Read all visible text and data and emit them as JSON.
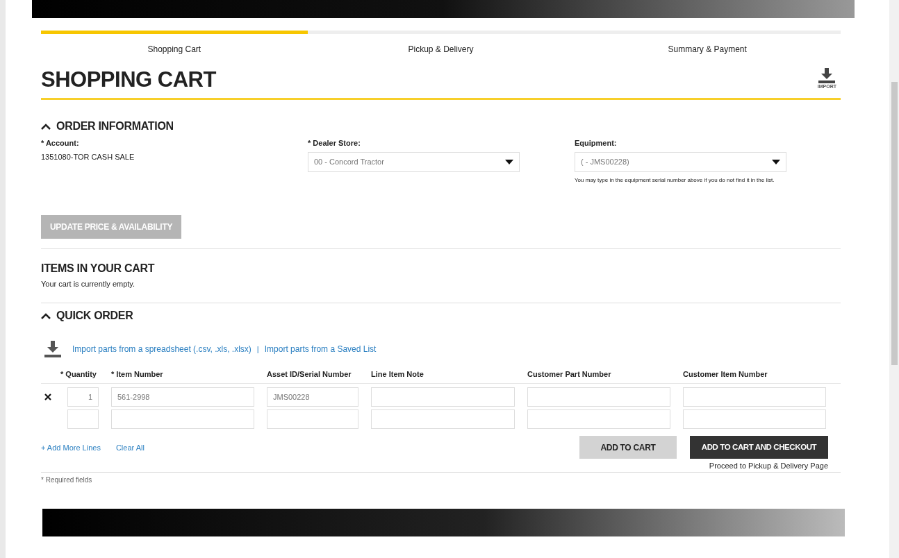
{
  "steps": [
    {
      "label": "Shopping Cart",
      "selected": true
    },
    {
      "label": "Pickup & Delivery",
      "selected": false
    },
    {
      "label": "Summary & Payment",
      "selected": false
    }
  ],
  "title": "SHOPPING CART",
  "import_button": {
    "label": "IMPORT"
  },
  "order_information": {
    "heading": "ORDER INFORMATION",
    "expanded": true,
    "account": {
      "label": "* Account:",
      "value": "1351080-TOR CASH SALE"
    },
    "dealer_store": {
      "label": "* Dealer Store:",
      "value": "00 - Concord Tractor"
    },
    "equipment": {
      "label": "Equipment:",
      "value": "( - JMS00228)",
      "help": "You may type in the equipment serial number above if you do not find it in the list."
    },
    "update_button": {
      "label": "UPDATE PRICE & AVAILABILITY",
      "disabled": true
    }
  },
  "cart": {
    "heading": "ITEMS IN YOUR CART",
    "message": "Your cart is currently empty."
  },
  "quick_order": {
    "heading": "QUICK ORDER",
    "expanded": true,
    "links": [
      "Import parts from a spreadsheet (.csv, .xls, .xlsx)",
      "Import parts from a Saved List"
    ],
    "separator": "|",
    "columns": [
      {
        "label": "* Quantity"
      },
      {
        "label": "* Item Number"
      },
      {
        "label": "Asset ID/Serial Number"
      },
      {
        "label": "Line Item Note"
      },
      {
        "label": "Customer Part Number"
      },
      {
        "label": "Customer Item Number"
      }
    ],
    "rows": [
      {
        "removable": true,
        "cells": [
          {
            "value": "1"
          },
          {
            "value": "561-2998"
          },
          {
            "value": "JMS00228"
          }
        ]
      },
      {
        "removable": false
      }
    ],
    "add_lines": "+ Add More Lines",
    "clear_all": "Clear All",
    "add_to_cart": {
      "label": "ADD TO CART",
      "disabled": true
    },
    "checkout": {
      "label": "ADD TO CART AND CHECKOUT",
      "note": "Proceed to Pickup & Delivery Page"
    },
    "required_note": "* Required fields"
  }
}
